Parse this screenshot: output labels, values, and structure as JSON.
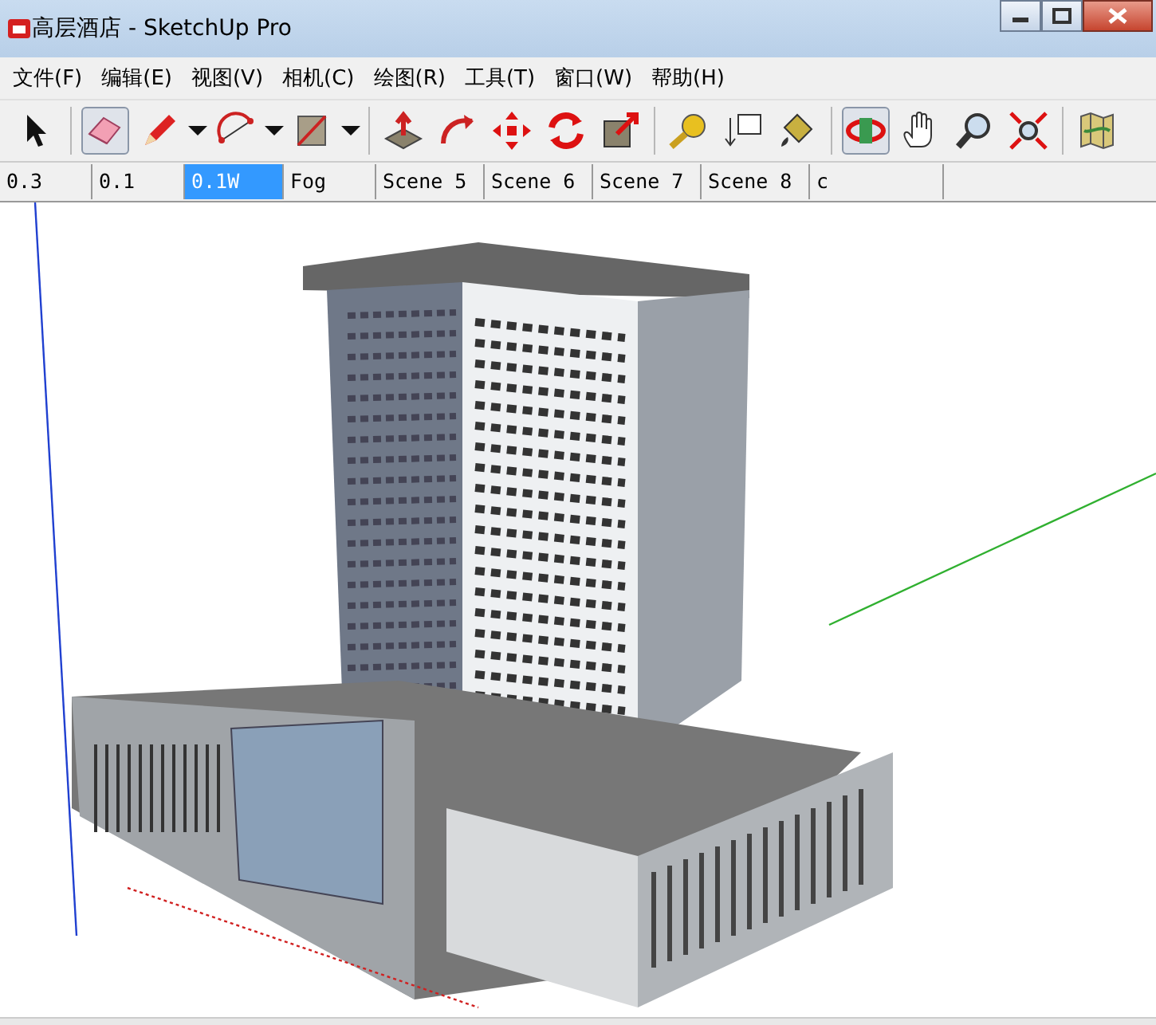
{
  "window": {
    "title": "高层酒店 - SketchUp Pro"
  },
  "menu": [
    "文件(F)",
    "编辑(E)",
    "视图(V)",
    "相机(C)",
    "绘图(R)",
    "工具(T)",
    "窗口(W)",
    "帮助(H)"
  ],
  "toolbar": [
    {
      "pressed": false,
      "dropdown": false
    },
    {
      "pressed": true,
      "dropdown": false
    },
    {
      "pressed": false,
      "dropdown": true
    },
    {
      "pressed": false,
      "dropdown": true
    },
    {
      "pressed": false,
      "dropdown": true
    },
    {
      "pressed": false,
      "dropdown": false
    },
    {
      "pressed": false,
      "dropdown": false
    },
    {
      "pressed": false,
      "dropdown": false
    },
    {
      "pressed": false,
      "dropdown": false
    },
    {
      "pressed": false,
      "dropdown": false
    },
    {
      "pressed": false,
      "dropdown": false
    },
    {
      "pressed": false,
      "dropdown": false
    },
    {
      "pressed": false,
      "dropdown": false
    },
    {
      "pressed": true,
      "dropdown": false
    },
    {
      "pressed": false,
      "dropdown": false
    },
    {
      "pressed": false,
      "dropdown": false
    },
    {
      "pressed": false,
      "dropdown": false
    },
    {
      "pressed": false,
      "dropdown": false
    }
  ],
  "scenes": [
    {
      "label": "0.3",
      "selected": false
    },
    {
      "label": "0.1",
      "selected": false
    },
    {
      "label": "0.1W",
      "selected": true
    },
    {
      "label": "Fog",
      "selected": false
    },
    {
      "label": "Scene 5",
      "selected": false
    },
    {
      "label": "Scene 6",
      "selected": false
    },
    {
      "label": "Scene 7",
      "selected": false
    },
    {
      "label": "Scene 8",
      "selected": false
    },
    {
      "label": "c",
      "selected": false
    }
  ]
}
